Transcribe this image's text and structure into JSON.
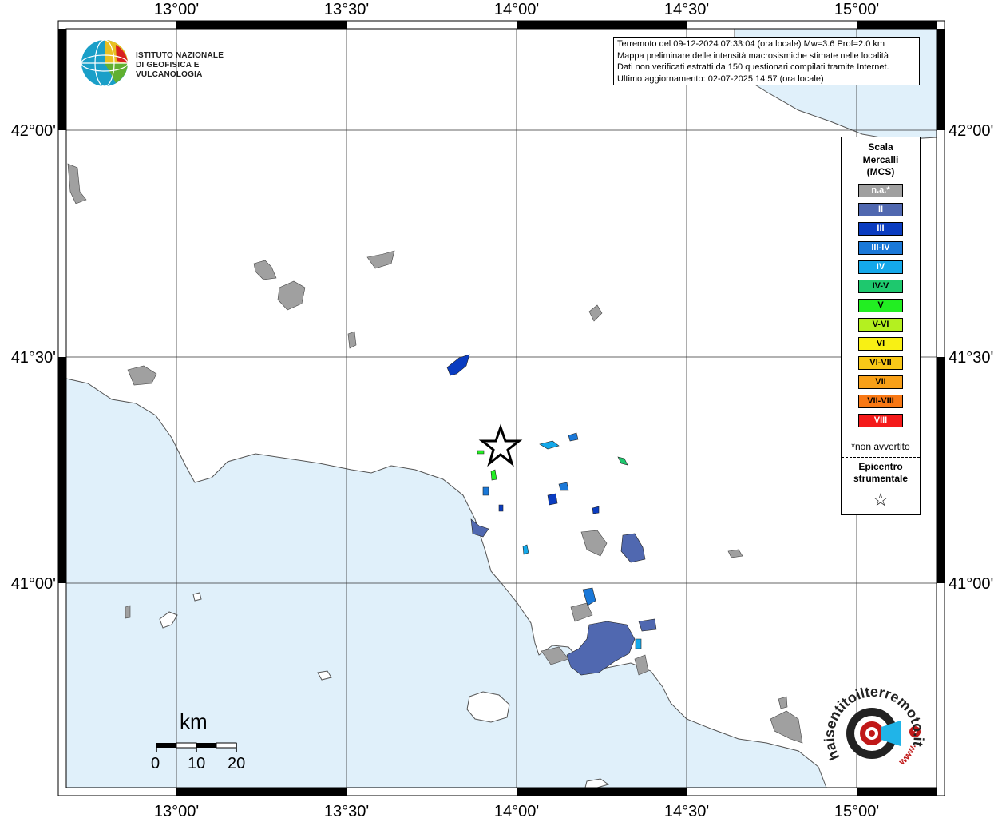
{
  "map": {
    "lon_labels": [
      "13°00'",
      "13°30'",
      "14°00'",
      "14°30'",
      "15°00'"
    ],
    "lat_labels": [
      "42°00'",
      "41°30'",
      "41°00'"
    ]
  },
  "info_box": {
    "lines": [
      "Terremoto del 09-12-2024 07:33:04 (ora locale) Mw=3.6 Prof=2.0 km",
      "Mappa preliminare delle intensità macrosismiche stimate nelle località",
      "Dati non verificati estratti da 150 questionari compilati tramite Internet.",
      "Ultimo aggiornamento: 02-07-2025 14:57 (ora locale)"
    ]
  },
  "logo": {
    "line1": "ISTITUTO NAZIONALE",
    "line2": "DI GEOFISICA E VULCANOLOGIA"
  },
  "legend": {
    "title_line1": "Scala",
    "title_line2": "Mercalli",
    "title_line3": "(MCS)",
    "classes": [
      {
        "label": "n.a.*",
        "color": "#a0a0a0",
        "text_color": "#ffffff"
      },
      {
        "label": "II",
        "color": "#5068b0",
        "text_color": "#ffffff"
      },
      {
        "label": "III",
        "color": "#0a3cc0",
        "text_color": "#ffffff"
      },
      {
        "label": "III-IV",
        "color": "#1a78d8",
        "text_color": "#ffffff"
      },
      {
        "label": "IV",
        "color": "#14a8ea",
        "text_color": "#ffffff"
      },
      {
        "label": "IV-V",
        "color": "#1ec86e",
        "text_color": "#000000"
      },
      {
        "label": "V",
        "color": "#22ee22",
        "text_color": "#000000"
      },
      {
        "label": "V-VI",
        "color": "#b4f020",
        "text_color": "#000000"
      },
      {
        "label": "VI",
        "color": "#f8f014",
        "text_color": "#000000"
      },
      {
        "label": "VI-VII",
        "color": "#f8c818",
        "text_color": "#000000"
      },
      {
        "label": "VII",
        "color": "#f8a018",
        "text_color": "#000000"
      },
      {
        "label": "VII-VIII",
        "color": "#f87814",
        "text_color": "#000000"
      },
      {
        "label": "VIII",
        "color": "#f41a1a",
        "text_color": "#ffffff"
      }
    ],
    "note": "*non avvertito",
    "epicenter_line1": "Epicentro",
    "epicenter_line2": "strumentale",
    "star_icon": "☆"
  },
  "scalebar": {
    "unit": "km",
    "ticks": [
      "0",
      "10",
      "20"
    ]
  },
  "branding": {
    "name": "haisentitoilterremoto.it",
    "www": "www."
  },
  "colors": {
    "sea": "#e0f0fa",
    "land": "#ffffff",
    "na": "#a0a0a0",
    "ii": "#5068b0",
    "iii": "#0a3cc0",
    "iii_iv": "#1a78d8",
    "iv": "#14a8ea",
    "iv_v": "#1ec86e",
    "v": "#22ee22"
  }
}
